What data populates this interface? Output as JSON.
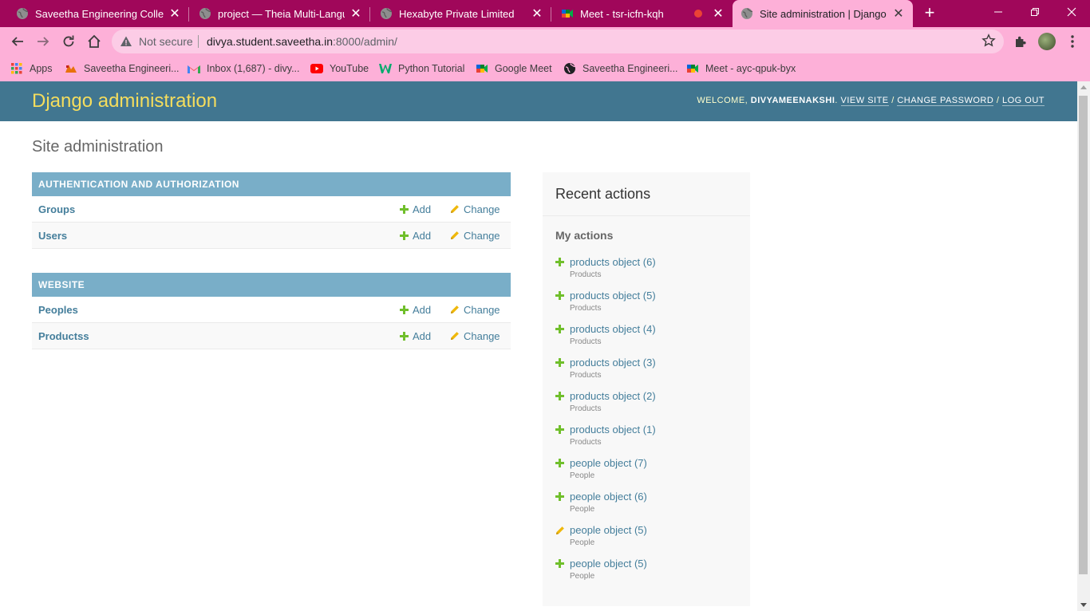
{
  "browser": {
    "tabs": [
      {
        "title": "Saveetha Engineering College",
        "favicon": "globe-icon"
      },
      {
        "title": "project — Theia Multi-Language",
        "favicon": "globe-icon"
      },
      {
        "title": "Hexabyte Private Limited",
        "favicon": "globe-icon"
      },
      {
        "title": "Meet - tsr-icfn-kqh",
        "favicon": "google-meet-icon"
      },
      {
        "title": "Site administration | Django site admin",
        "favicon": "globe-icon",
        "active": true
      }
    ],
    "new_tab_label": "+",
    "address": {
      "security_label": "Not secure",
      "host": "divya.student.saveetha.in",
      "path": ":8000/admin/"
    },
    "bookmarks": [
      {
        "label": "Apps",
        "icon": "apps-grid-icon"
      },
      {
        "label": "Saveetha Engineeri...",
        "icon": "saveetha-logo-icon"
      },
      {
        "label": "Inbox (1,687) - divy...",
        "icon": "gmail-icon"
      },
      {
        "label": "YouTube",
        "icon": "youtube-icon"
      },
      {
        "label": "Python Tutorial",
        "icon": "w3schools-icon"
      },
      {
        "label": "Google Meet",
        "icon": "google-meet-icon"
      },
      {
        "label": "Saveetha Engineeri...",
        "icon": "globe-icon"
      },
      {
        "label": "Meet - ayc-qpuk-byx",
        "icon": "google-meet-icon"
      }
    ],
    "colors": {
      "tabstrip": "#a0075a",
      "toolbar": "#fdb0d8"
    }
  },
  "header": {
    "branding": "Django administration",
    "welcome": "WELCOME,",
    "username": "DIVYAMEENAKSHI",
    "view_site": "VIEW SITE",
    "change_password": "CHANGE PASSWORD",
    "log_out": "LOG OUT"
  },
  "main": {
    "title": "Site administration",
    "apps": [
      {
        "caption": "AUTHENTICATION AND AUTHORIZATION",
        "models": [
          {
            "name": "Groups",
            "add": "Add",
            "change": "Change"
          },
          {
            "name": "Users",
            "add": "Add",
            "change": "Change"
          }
        ]
      },
      {
        "caption": "WEBSITE",
        "models": [
          {
            "name": "Peoples",
            "add": "Add",
            "change": "Change"
          },
          {
            "name": "Productss",
            "add": "Add",
            "change": "Change"
          }
        ]
      }
    ]
  },
  "recent": {
    "title": "Recent actions",
    "subtitle": "My actions",
    "actions": [
      {
        "name": "products object (6)",
        "model": "Products",
        "type": "add"
      },
      {
        "name": "products object (5)",
        "model": "Products",
        "type": "add"
      },
      {
        "name": "products object (4)",
        "model": "Products",
        "type": "add"
      },
      {
        "name": "products object (3)",
        "model": "Products",
        "type": "add"
      },
      {
        "name": "products object (2)",
        "model": "Products",
        "type": "add"
      },
      {
        "name": "products object (1)",
        "model": "Products",
        "type": "add"
      },
      {
        "name": "people object (7)",
        "model": "People",
        "type": "add"
      },
      {
        "name": "people object (6)",
        "model": "People",
        "type": "add"
      },
      {
        "name": "people object (5)",
        "model": "People",
        "type": "change"
      },
      {
        "name": "people object (5)",
        "model": "People",
        "type": "add"
      }
    ]
  },
  "colors": {
    "header_bg": "#417690",
    "branding": "#f5dd5d",
    "caption_bg": "#79aec8",
    "link": "#447e9b",
    "add_green": "#70bf2b",
    "change_yellow": "#efb80b"
  }
}
